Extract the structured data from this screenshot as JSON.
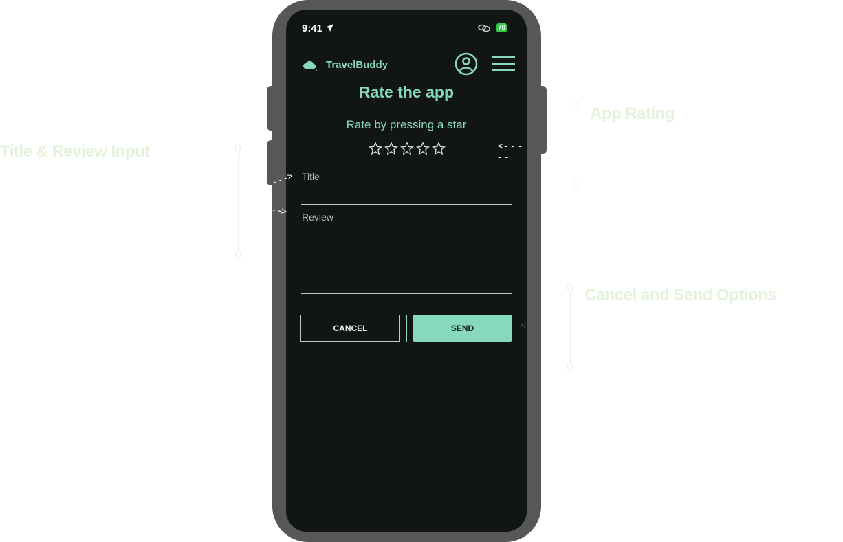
{
  "annotations": {
    "rating": "App Rating",
    "inputs": "Title & Review Input",
    "buttons": "Cancel and Send Options"
  },
  "status": {
    "time": "9:41",
    "battery": "78"
  },
  "header": {
    "brand": "TravelBuddy",
    "profile_icon": "user-circle-icon",
    "menu_icon": "hamburger-menu-icon"
  },
  "page": {
    "title": "Rate the app",
    "subtitle": "Rate by pressing a star",
    "rating": 0,
    "max_rating": 5
  },
  "form": {
    "title_label": "Title",
    "title_value": "",
    "review_label": "Review",
    "review_value": ""
  },
  "actions": {
    "cancel": "CANCEL",
    "send": "SEND"
  },
  "colors": {
    "accent": "#86d9bc",
    "screen_bg": "#111613",
    "frame": "#575757",
    "annotation": "#e4f2dc"
  }
}
